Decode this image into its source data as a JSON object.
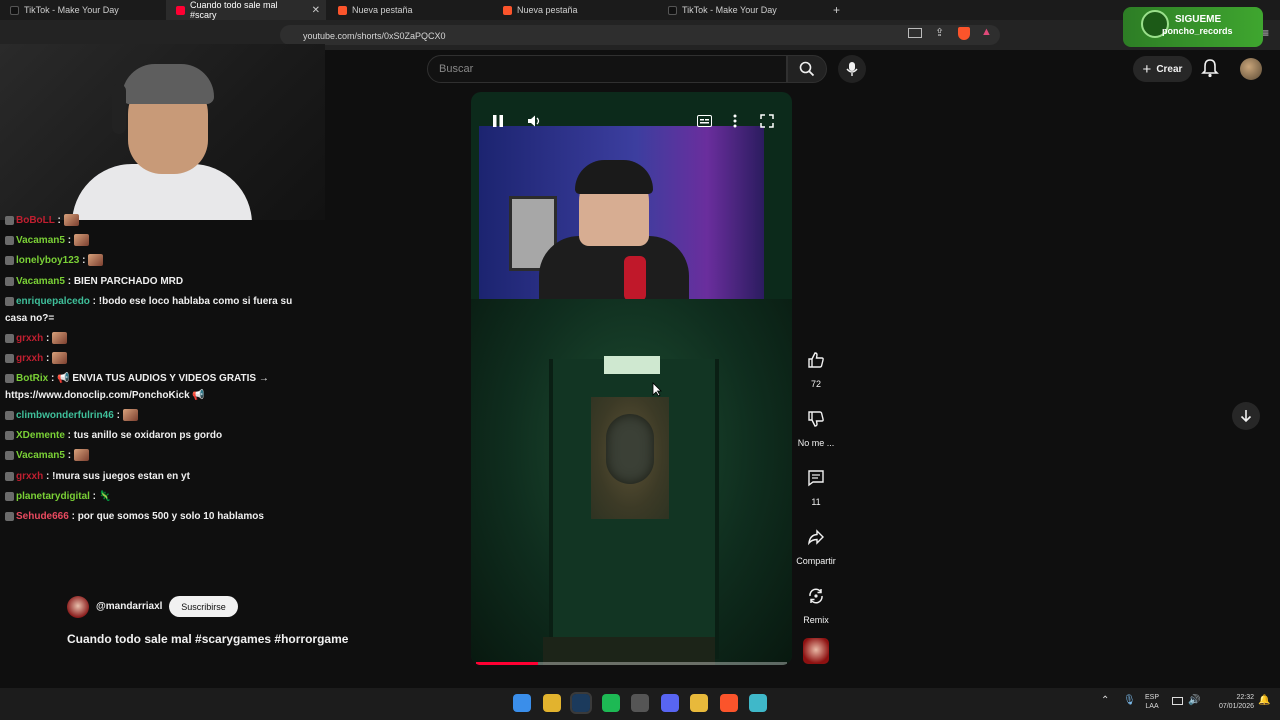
{
  "browser": {
    "tabs": [
      {
        "label": "TikTok - Make Your Day",
        "color": "#222222"
      },
      {
        "label": "Cuando todo sale mal #scary",
        "color": "#ff0033"
      },
      {
        "label": "Nueva pestaña",
        "color": "#fb542b"
      },
      {
        "label": "Nueva pestaña",
        "color": "#fb542b"
      },
      {
        "label": "TikTok - Make Your Day",
        "color": "#222222"
      }
    ],
    "new_tab": "+",
    "url": "youtube.com/shorts/0xS0ZaPQCX0"
  },
  "youtube": {
    "search_placeholder": "Buscar",
    "create_label": "Crear",
    "icons": [
      "search-icon",
      "mic-icon",
      "bell-icon",
      "plus-icon"
    ]
  },
  "overlay": {
    "follow_line1": "SIGUEME",
    "follow_line2": "poncho_records"
  },
  "chat": {
    "messages": [
      {
        "user": "BoBoLL",
        "user_color": "#c01f30",
        "text": "",
        "emote": true
      },
      {
        "user": "Vacaman5",
        "user_color": "#7ad036",
        "text": "",
        "emote": true
      },
      {
        "user": "lonelyboy123",
        "user_color": "#7ad036",
        "text": "",
        "emote": true
      },
      {
        "user": "Vacaman5",
        "user_color": "#7ad036",
        "text": "BIEN PARCHADO MRD",
        "emote": false
      },
      {
        "user": "enriquepalcedo",
        "user_color": "#3fbf9a",
        "text": "!bodo ese loco hablaba como si fuera su",
        "emote": false
      },
      {
        "user": "",
        "user_color": "#efefef",
        "text": "casa no?=",
        "emote": false
      },
      {
        "user": "grxxh",
        "user_color": "#c01f30",
        "text": "",
        "emote": true
      },
      {
        "user": "grxxh",
        "user_color": "#c01f30",
        "text": "",
        "emote": true
      },
      {
        "user": "BotRix",
        "user_color": "#7ad036",
        "text": "📢 ENVIA TUS AUDIOS Y VIDEOS GRATIS →",
        "emote": false
      },
      {
        "user": "",
        "user_color": "#efefef",
        "text": "https://www.donoclip.com/PonchoKick 📢",
        "emote": false
      },
      {
        "user": "climbwonderfulrin46",
        "user_color": "#3fbf9a",
        "text": "",
        "emote": true
      },
      {
        "user": "XDemente",
        "user_color": "#7ad036",
        "text": "tus anillo se oxidaron ps gordo",
        "emote": false
      },
      {
        "user": "Vacaman5",
        "user_color": "#7ad036",
        "text": "",
        "emote": true
      },
      {
        "user": "grxxh",
        "user_color": "#c01f30",
        "text": "!mura sus juegos estan en yt",
        "emote": false
      },
      {
        "user": "planetarydigital",
        "user_color": "#7ad036",
        "text": "🦎",
        "emote": false
      },
      {
        "user": "Sehude666",
        "user_color": "#e84a5f",
        "text": "por que somos 500 y solo 10 hablamos",
        "emote": false
      }
    ]
  },
  "short": {
    "channel": "@mandarriaxl",
    "subscribe_label": "Suscribirse",
    "title": "Cuando todo sale mal #scarygames #horrorgame",
    "progress_pct": 20,
    "actions": {
      "like_count": "72",
      "dislike_label": "No me ...",
      "comments_count": "11",
      "share_label": "Compartir",
      "remix_label": "Remix"
    }
  },
  "taskbar": {
    "lang_line1": "ESP",
    "lang_line2": "LAA",
    "time": "22:32",
    "date": "07/01/2026",
    "icons": [
      {
        "name": "windows-start-icon",
        "color": "#3a8eea"
      },
      {
        "name": "chrome-icon",
        "color": "#e2b32e"
      },
      {
        "name": "steam-icon",
        "color": "#1b3a5c"
      },
      {
        "name": "spotify-icon",
        "color": "#1db954"
      },
      {
        "name": "obs-icon",
        "color": "#555555"
      },
      {
        "name": "discord-icon",
        "color": "#5865f2"
      },
      {
        "name": "file-explorer-icon",
        "color": "#e8b93b"
      },
      {
        "name": "brave-icon",
        "color": "#fb542b"
      },
      {
        "name": "app-icon",
        "color": "#3fb8c9"
      }
    ]
  }
}
